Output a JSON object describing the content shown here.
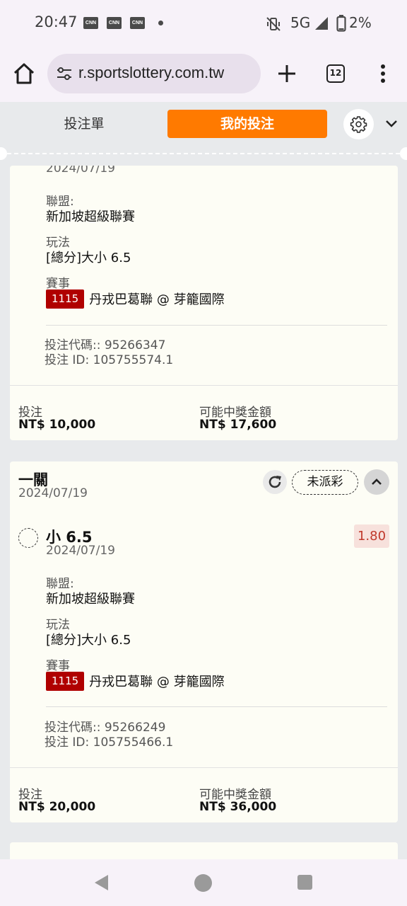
{
  "status_bar": {
    "time": "20:47",
    "notifications": [
      "CNN",
      "CNN",
      "CNN"
    ],
    "network": "5G",
    "battery": "2%"
  },
  "browser": {
    "url": "r.sportslottery.com.tw",
    "tab_count": "12"
  },
  "header": {
    "tab_bet_slip": "投注單",
    "tab_my_bets": "我的投注",
    "accent_color": "#ff7a00"
  },
  "bets": [
    {
      "date": "2024/07/19",
      "league_label": "聯盟:",
      "league": "新加坡超級聯賽",
      "market_label": "玩法",
      "market": "[總分]大小 6.5",
      "event_label": "賽事",
      "match_no": "1115",
      "match": "丹戎巴葛聯 @ 芽籠國際",
      "bet_code": "投注代碼:: 95266347",
      "bet_id": "投注 ID: 105755574.1",
      "stake_label": "投注",
      "stake": "NT$ 10,000",
      "payout_label": "可能中獎金額",
      "payout": "NT$ 17,600"
    },
    {
      "type": "一關",
      "date": "2024/07/19",
      "status": "未派彩",
      "selection": "小 6.5",
      "selection_date": "2024/07/19",
      "odds": "1.80",
      "league_label": "聯盟:",
      "league": "新加坡超級聯賽",
      "market_label": "玩法",
      "market": "[總分]大小 6.5",
      "event_label": "賽事",
      "match_no": "1115",
      "match": "丹戎巴葛聯 @ 芽籠國際",
      "bet_code": "投注代碼:: 95266249",
      "bet_id": "投注 ID: 105755466.1",
      "stake_label": "投注",
      "stake": "NT$ 20,000",
      "payout_label": "可能中獎金額",
      "payout": "NT$ 36,000"
    }
  ]
}
